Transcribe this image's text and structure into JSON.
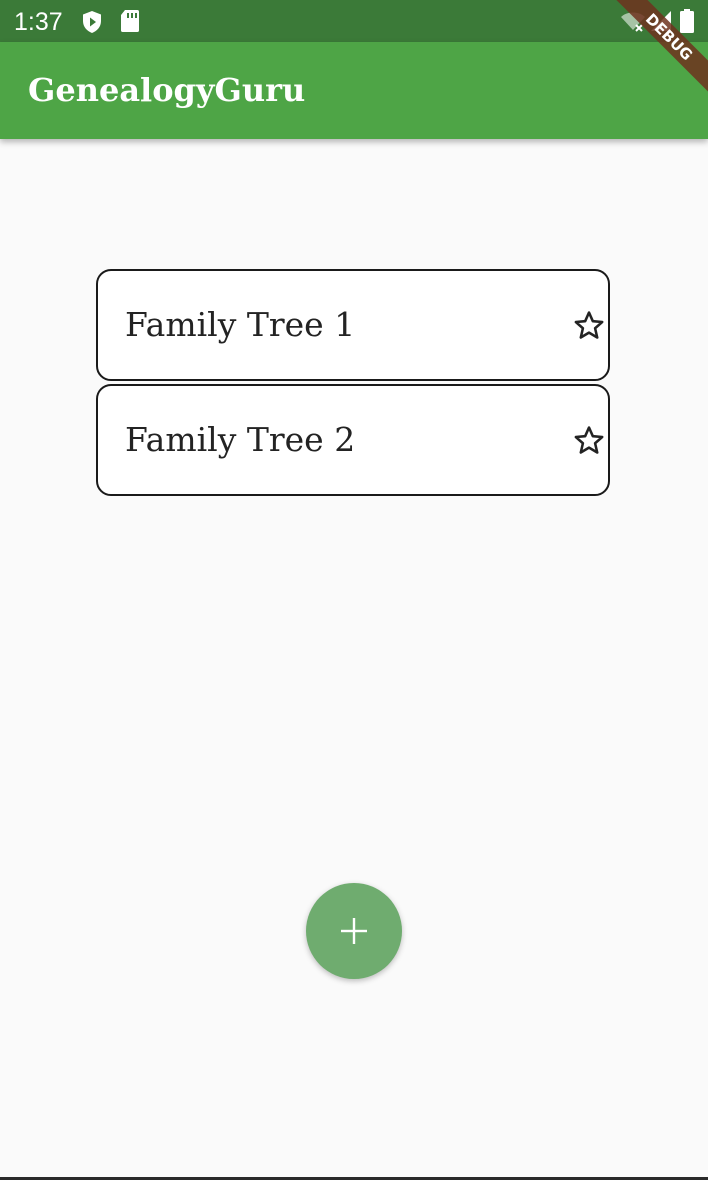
{
  "status_bar": {
    "time": "1:37",
    "left_icons": [
      "play-shield-icon",
      "sd-card-icon"
    ],
    "right_icons": [
      "wifi-off-icon",
      "signal-icon",
      "battery-icon"
    ]
  },
  "app_bar": {
    "title": "GenealogyGuru"
  },
  "debug_banner": {
    "label": "DEBUG"
  },
  "family_trees": [
    {
      "name": "Family Tree 1",
      "favorite": false,
      "icon": "star-outline-icon"
    },
    {
      "name": "Family Tree 2",
      "favorite": false,
      "icon": "star-outline-icon"
    }
  ],
  "fab": {
    "icon": "plus-icon"
  },
  "colors": {
    "status_bar": "#3b7a38",
    "app_bar": "#4ea546",
    "fab": "#6fac6f",
    "background": "#fafafa"
  }
}
